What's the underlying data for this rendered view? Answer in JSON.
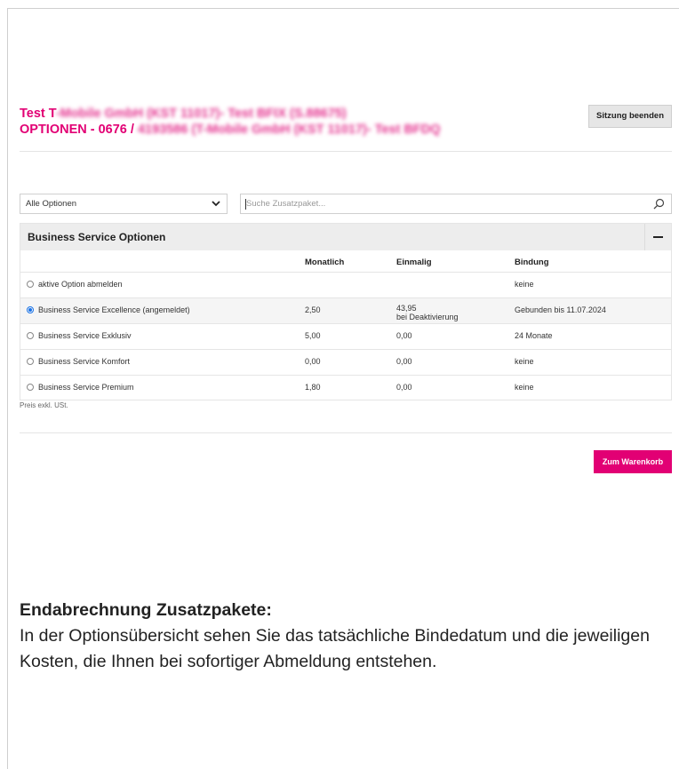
{
  "header": {
    "title_line1_prefix": "Test T",
    "title_line1_redacted": "-Mobile GmbH (KST 11017)- Test BFIX (S.88675)",
    "title_line2_prefix": "OPTIONEN - 0676 / ",
    "title_line2_redacted": "4193586 (T-Mobile GmbH (KST 11017)- Test BFDQ",
    "end_session_label": "Sitzung beenden"
  },
  "filters": {
    "select_value": "Alle Optionen",
    "search_placeholder": "Suche Zusatzpaket..."
  },
  "panel": {
    "title": "Business Service Optionen",
    "columns": [
      "Monatlich",
      "Einmalig",
      "Bindung"
    ],
    "rows": [
      {
        "name": "aktive Option abmelden",
        "monthly": "",
        "once": "",
        "once_note": "",
        "binding": "keine",
        "selected": false
      },
      {
        "name": "Business Service Excellence (angemeldet)",
        "monthly": "2,50",
        "once": "43,95",
        "once_note": "bei Deaktivierung",
        "binding": "Gebunden bis 11.07.2024",
        "selected": true
      },
      {
        "name": "Business Service Exklusiv",
        "monthly": "5,00",
        "once": "0,00",
        "once_note": "",
        "binding": "24 Monate",
        "selected": false
      },
      {
        "name": "Business Service Komfort",
        "monthly": "0,00",
        "once": "0,00",
        "once_note": "",
        "binding": "keine",
        "selected": false
      },
      {
        "name": "Business Service Premium",
        "monthly": "1,80",
        "once": "0,00",
        "once_note": "",
        "binding": "keine",
        "selected": false
      }
    ]
  },
  "price_note": "Preis exkl. USt.",
  "cart_button_label": "Zum Warenkorb",
  "caption": {
    "heading": "Endabrechnung Zusatzpakete:",
    "text": "In der Optionsübersicht sehen Sie das tatsächliche Bindedatum und die jeweiligen Kosten, die Ihnen bei sofortiger Abmeldung entstehen."
  },
  "colors": {
    "brand_magenta": "#e20074",
    "radio_blue": "#1a73e8"
  }
}
